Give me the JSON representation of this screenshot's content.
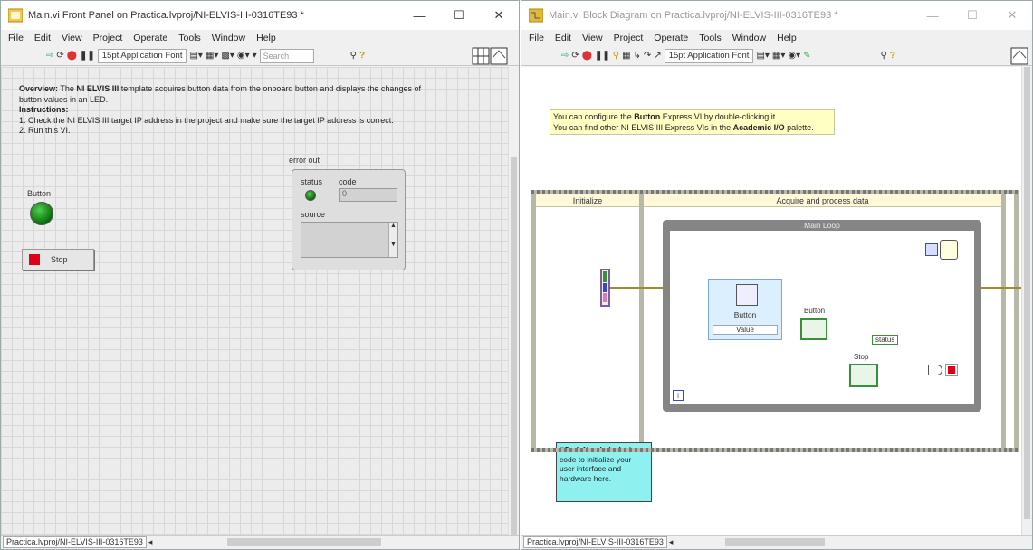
{
  "front_panel": {
    "title": "Main.vi Front Panel on Practica.lvproj/NI-ELVIS-III-0316TE93 *",
    "menu": [
      "File",
      "Edit",
      "View",
      "Project",
      "Operate",
      "Tools",
      "Window",
      "Help"
    ],
    "font_selector": "15pt Application Font",
    "search_placeholder": "Search",
    "overview_label": "Overview:",
    "overview_text": " The ",
    "overview_strong": "NI ELVIS III",
    "overview_rest": " template acquires button data from the onboard button and displays the changes of button values in an LED.",
    "instructions_label": "Instructions:",
    "instruction_1": "1. Check the NI ELVIS III target IP address in the project and make sure the target IP address is correct.",
    "instruction_2": "2. Run this VI.",
    "button_label": "Button",
    "stop_label": "Stop",
    "error_out": {
      "title": "error out",
      "status_label": "status",
      "code_label": "code",
      "code_value": "0",
      "source_label": "source"
    },
    "status_path": "Practica.lvproj/NI-ELVIS-III-0316TE93"
  },
  "block_diagram": {
    "title": "Main.vi Block Diagram on Practica.lvproj/NI-ELVIS-III-0316TE93 *",
    "menu": [
      "File",
      "Edit",
      "View",
      "Project",
      "Operate",
      "Tools",
      "Window",
      "Help"
    ],
    "font_selector": "15pt Application Font",
    "comment_line1_a": "You can configure the ",
    "comment_line1_b": "Button",
    "comment_line1_c": " Express VI by double-clicking it.",
    "comment_line2_a": "You can find other NI ELVIS III Express VIs in the ",
    "comment_line2_b": "Academic I/O",
    "comment_line2_c": " palette.",
    "frame_initialize": "Initialize",
    "frame_acquire": "Acquire and process data",
    "loop_title": "Main Loop",
    "express_vi_name": "Button",
    "express_vi_output": "Value",
    "button_indicator": "Button",
    "status_terminal": "status",
    "stop_terminal": "Stop",
    "todo_strong": "#CodeNeeded",
    "todo_text": " - Add code to initialize your user interface and hardware here.",
    "loop_iteration": "i",
    "status_path": "Practica.lvproj/NI-ELVIS-III-0316TE93"
  }
}
